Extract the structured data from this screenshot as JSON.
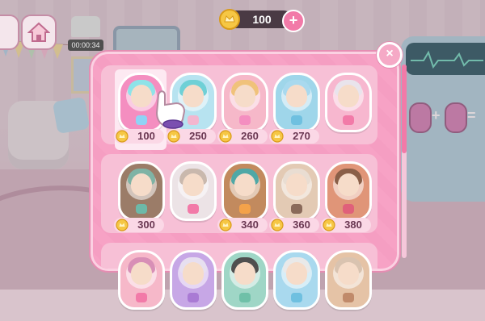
{
  "hud": {
    "timer": "00:00:34",
    "coins": "100",
    "plus": "+"
  },
  "shop": {
    "close": "×",
    "selected_index": 0,
    "items": [
      {
        "price": "100",
        "capsule": "#f48ec0",
        "hair": "#8ee3e8",
        "badge": "#8fd3f5"
      },
      {
        "price": "250",
        "capsule": "#b7e3f0",
        "hair": "#6fd0d6",
        "badge": "#f3b6cf"
      },
      {
        "price": "260",
        "capsule": "#f6b8c9",
        "hair": "#f0c27a",
        "badge": "#f48ec0"
      },
      {
        "price": "270",
        "capsule": "#9fd6ea",
        "hair": "#a9d9ee",
        "badge": "#6fc0e0"
      },
      {
        "price": "",
        "capsule": "#f7b7cf",
        "hair": "#e9e4ec",
        "badge": "#f27aa8"
      },
      {
        "price": "300",
        "capsule": "#9b7c68",
        "hair": "#7fb3a5",
        "badge": "#6db9a8"
      },
      {
        "price": "",
        "capsule": "#ece3e6",
        "hair": "#c9b8ad",
        "badge": "#f27aa8"
      },
      {
        "price": "340",
        "capsule": "#c28a5e",
        "hair": "#4fa8a6",
        "badge": "#f4a24a"
      },
      {
        "price": "360",
        "capsule": "#e3cab4",
        "hair": "#e9ddd2",
        "badge": "#8a6a5a"
      },
      {
        "price": "380",
        "capsule": "#e09578",
        "hair": "#8a5f48",
        "badge": "#e0607a"
      },
      {
        "price": "",
        "capsule": "#f6b8c9",
        "hair": "#d88fb6",
        "badge": "#f27aa8"
      },
      {
        "price": "",
        "capsule": "#c7a7e6",
        "hair": "#e7dff0",
        "badge": "#a97ad4"
      },
      {
        "price": "",
        "capsule": "#9fd6c6",
        "hair": "#4f4f4f",
        "badge": "#6fc0a8"
      },
      {
        "price": "",
        "capsule": "#a9d9ee",
        "hair": "#e9e9e9",
        "badge": "#6fc0e0"
      },
      {
        "price": "",
        "capsule": "#e5c3a6",
        "hair": "#d9c3b0",
        "badge": "#c08a6a"
      }
    ]
  }
}
